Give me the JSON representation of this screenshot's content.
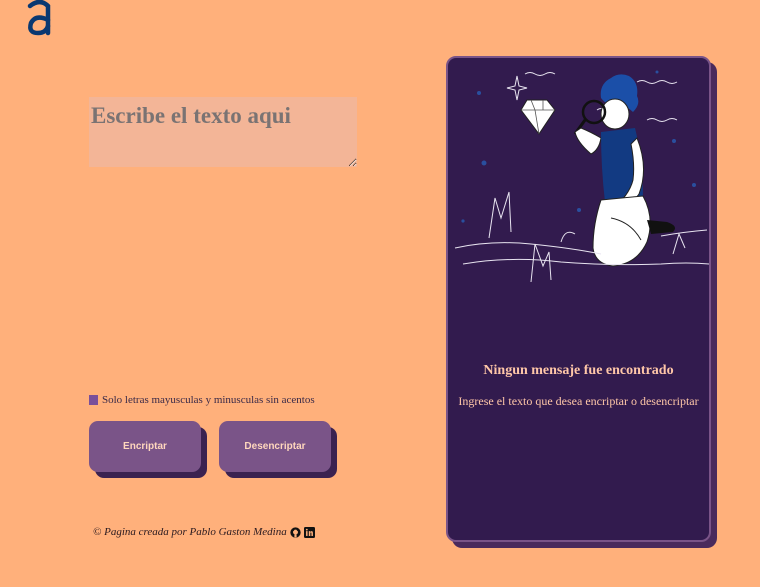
{
  "logo": {
    "icon": "alura-logo-icon",
    "color": "#0a3871"
  },
  "input": {
    "placeholder": "Escribe el texto aqui",
    "value": ""
  },
  "info": {
    "icon": "info-icon",
    "text": "Solo letras mayusculas y minusculas sin acentos"
  },
  "buttons": {
    "encrypt": "Encriptar",
    "decrypt": "Desencriptar"
  },
  "footer": {
    "text": "© Pagina creada por Pablo Gaston Medina",
    "icons": [
      "github-icon",
      "linkedin-icon"
    ]
  },
  "output": {
    "image": "person-with-magnifying-glass-illustration",
    "title": "Ningun mensaje fue encontrado",
    "subtitle": "Ingrese el texto que desea encriptar o desencriptar"
  },
  "colors": {
    "background": "#ffb07b",
    "panel": "#321b4e",
    "button": "#7a5488",
    "button_text": "#ffd7bd",
    "accent_text": "#ffc7a8"
  }
}
